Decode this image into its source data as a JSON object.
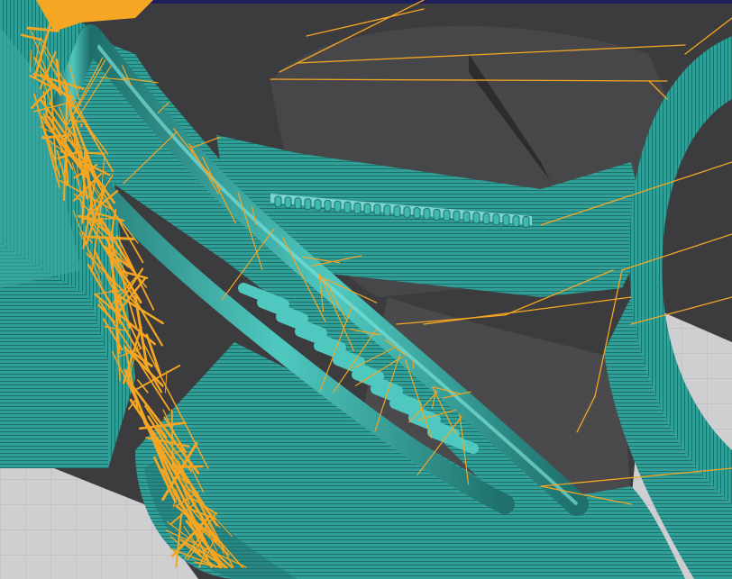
{
  "viewport": {
    "kind": "3d-gcode-preview",
    "colors": {
      "background": "#3c3c3e",
      "top_bar": "#1c1f5a",
      "bed_plate": "#cfcfd1",
      "shell_dark": "#1f6f6b",
      "shell_mid": "#2f9f98",
      "shell_light": "#4fc9c0",
      "travel_moves": "#f5a623"
    },
    "layers": [
      {
        "name": "perimeters",
        "color": "#2f9f98",
        "visible": true
      },
      {
        "name": "infill",
        "color": "#3fb8b0",
        "visible": true
      },
      {
        "name": "travel",
        "color": "#f5a623",
        "visible": true
      },
      {
        "name": "build-plate",
        "color": "#cfcfd1",
        "visible": true
      }
    ]
  }
}
